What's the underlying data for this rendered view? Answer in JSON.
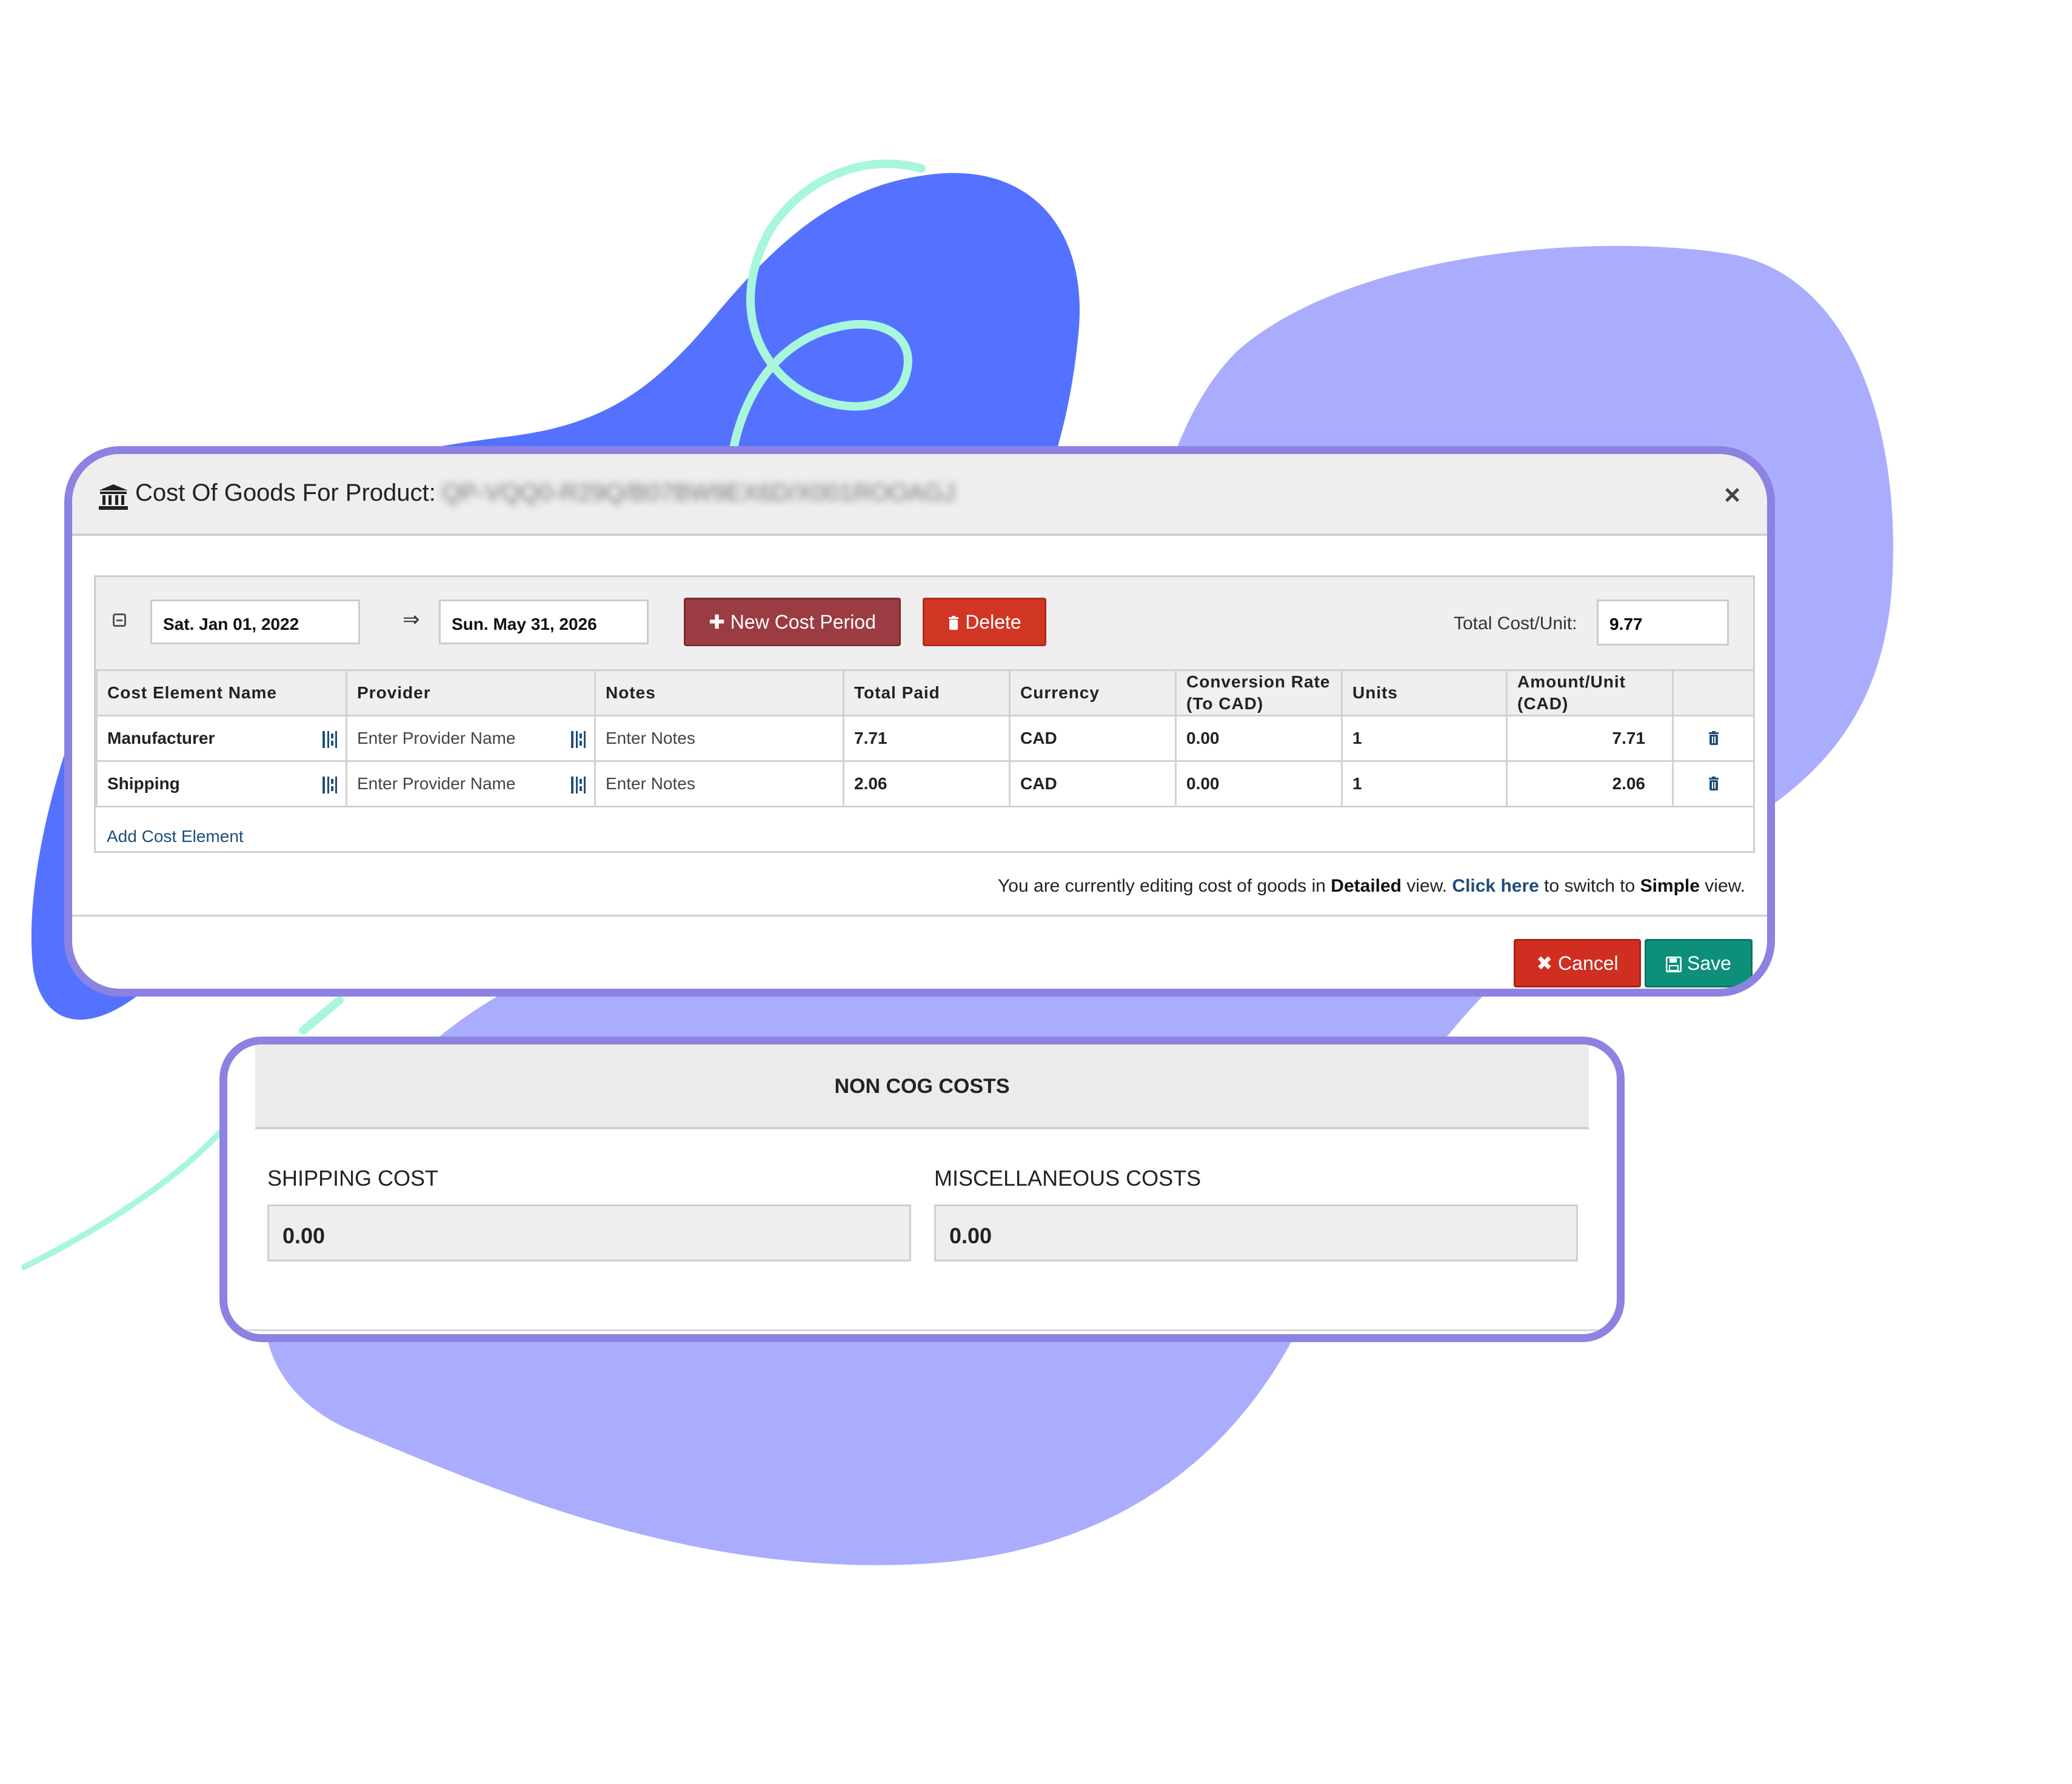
{
  "colors": {
    "blob_blue": "#5472ff",
    "blob_lavender": "#aaadfd",
    "swirl_mint": "#a8f7dc",
    "frame_border": "#8c82e2",
    "new_cost_period": "#9b3c43",
    "delete": "#d13625",
    "cancel": "#d12e22",
    "save": "#0e8f7a",
    "link": "#1f4e79"
  },
  "dialog": {
    "title": "Cost Of Goods For Product:",
    "product_id": "QP-VQQ0-R29Q/B07BW9EX6D/X001ROOAGJ",
    "title_icon": "bank-icon",
    "close_label": "×"
  },
  "period": {
    "start_date": "Sat. Jan 01, 2022",
    "arrow": "⇒",
    "end_date": "Sun. May 31, 2026",
    "new_button": "New Cost Period",
    "delete_button": "Delete",
    "total_label": "Total Cost/Unit:",
    "total_value": "9.77"
  },
  "table": {
    "headers": [
      "Cost Element Name",
      "Provider",
      "Notes",
      "Total Paid",
      "Currency",
      "Conversion Rate (To CAD)",
      "Units",
      "Amount/Unit (CAD)",
      ""
    ],
    "rows": [
      {
        "name": "Manufacturer",
        "provider": "Enter Provider Name",
        "notes": "Enter Notes",
        "total_paid": "7.71",
        "currency": "CAD",
        "conversion_rate": "0.00",
        "units": "1",
        "amount_per_unit": "7.71"
      },
      {
        "name": "Shipping",
        "provider": "Enter Provider Name",
        "notes": "Enter Notes",
        "total_paid": "2.06",
        "currency": "CAD",
        "conversion_rate": "0.00",
        "units": "1",
        "amount_per_unit": "2.06"
      }
    ],
    "add_link": "Add Cost Element"
  },
  "view_note": {
    "prefix": "You are currently editing cost of goods in",
    "mode": "Detailed",
    "middle": "view.",
    "link": "Click here",
    "suffix": "to switch to",
    "alt_mode": "Simple",
    "end": "view."
  },
  "footer": {
    "cancel": "Cancel",
    "save": "Save"
  },
  "non_cog": {
    "title": "NON COG COSTS",
    "shipping_label": "SHIPPING COST",
    "shipping_value": "0.00",
    "misc_label": "MISCELLANEOUS COSTS",
    "misc_value": "0.00"
  }
}
